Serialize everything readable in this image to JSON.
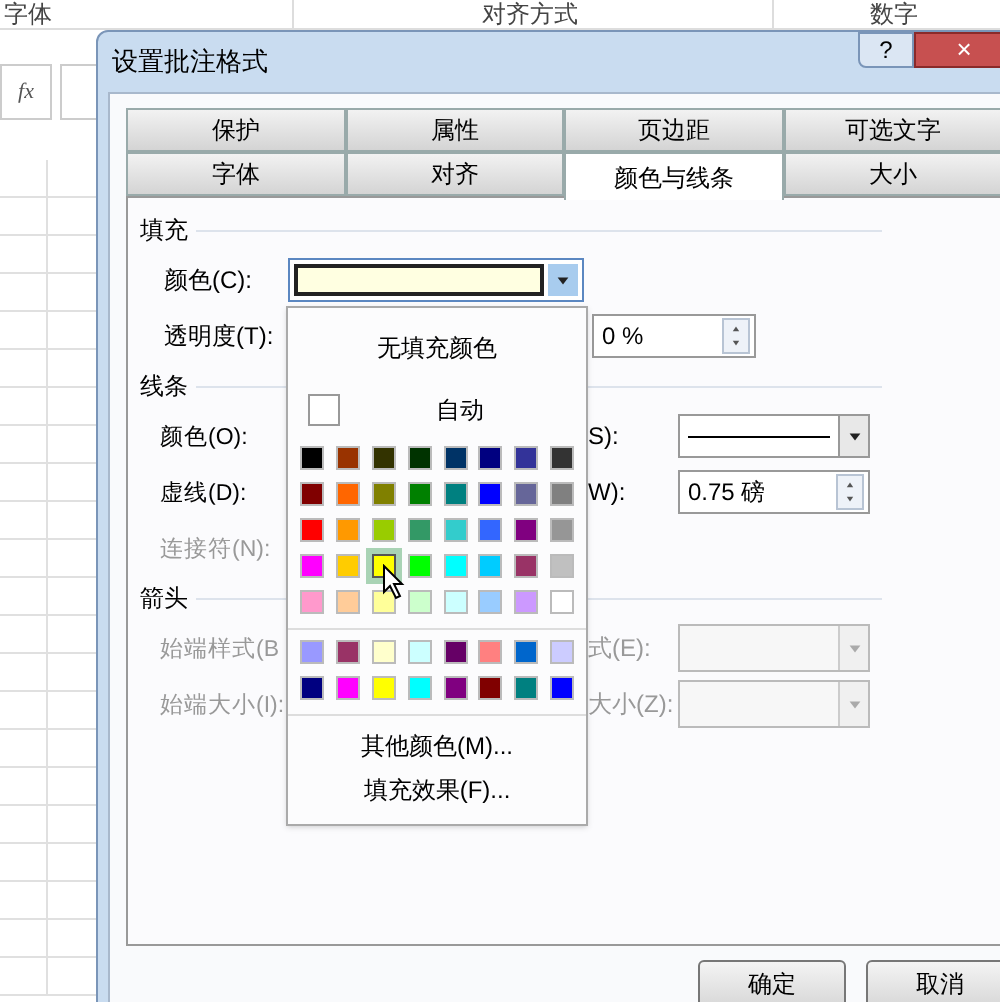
{
  "ribbon_groups": [
    "字体",
    "对齐方式",
    "数字"
  ],
  "formula_bar": {
    "fx": "fx"
  },
  "window": {
    "title": "设置批注格式",
    "help": "?",
    "close": "×"
  },
  "tab_rows": [
    [
      {
        "label": "保护",
        "selected": false
      },
      {
        "label": "属性",
        "selected": false
      },
      {
        "label": "页边距",
        "selected": false
      },
      {
        "label": "可选文字",
        "selected": false
      }
    ],
    [
      {
        "label": "字体",
        "selected": false
      },
      {
        "label": "对齐",
        "selected": false
      },
      {
        "label": "颜色与线条",
        "selected": true
      },
      {
        "label": "大小",
        "selected": false
      }
    ]
  ],
  "fill": {
    "title": "填充",
    "color_label": "颜色(C):",
    "transparency_label": "透明度(T):",
    "transparency_value": "0 %"
  },
  "line": {
    "title": "线条",
    "rows": [
      {
        "label": "颜色(O):",
        "disabled": false,
        "right_label": "S):",
        "kind": "line"
      },
      {
        "label": "虚线(D):",
        "disabled": false,
        "right_label": "W):",
        "kind": "spin",
        "right_value": "0.75 磅"
      },
      {
        "label": "连接符(N):",
        "disabled": true
      }
    ]
  },
  "arrows": {
    "title": "箭头",
    "rows": [
      {
        "label": "始端样式(B",
        "disabled": true,
        "right_label": "式(E):",
        "kind": "combo"
      },
      {
        "label": "始端大小(I):",
        "disabled": true,
        "right_label": "大小(Z):",
        "kind": "combo"
      }
    ]
  },
  "color_popup": {
    "no_fill": "无填充颜色",
    "auto": "自动",
    "more_colors": "其他颜色(M)...",
    "fill_effects": "填充效果(F)...",
    "swatch_groups": [
      {
        "swatches": [
          {
            "color": "#000000",
            "selected": false
          },
          {
            "color": "#993300",
            "selected": false
          },
          {
            "color": "#333300",
            "selected": false
          },
          {
            "color": "#003300",
            "selected": false
          },
          {
            "color": "#003366",
            "selected": false
          },
          {
            "color": "#000080",
            "selected": false
          },
          {
            "color": "#333399",
            "selected": false
          },
          {
            "color": "#333333",
            "selected": false
          },
          {
            "color": "#800000",
            "selected": false
          },
          {
            "color": "#ff6600",
            "selected": false
          },
          {
            "color": "#808000",
            "selected": false
          },
          {
            "color": "#008000",
            "selected": false
          },
          {
            "color": "#008080",
            "selected": false
          },
          {
            "color": "#0000ff",
            "selected": false
          },
          {
            "color": "#666699",
            "selected": false
          },
          {
            "color": "#808080",
            "selected": false
          },
          {
            "color": "#ff0000",
            "selected": false
          },
          {
            "color": "#ff9900",
            "selected": false
          },
          {
            "color": "#99cc00",
            "selected": false
          },
          {
            "color": "#339966",
            "selected": false
          },
          {
            "color": "#33cccc",
            "selected": false
          },
          {
            "color": "#3366ff",
            "selected": false
          },
          {
            "color": "#800080",
            "selected": false
          },
          {
            "color": "#969696",
            "selected": false
          },
          {
            "color": "#ff00ff",
            "selected": false
          },
          {
            "color": "#ffcc00",
            "selected": false
          },
          {
            "color": "#ffff00",
            "selected": true
          },
          {
            "color": "#00ff00",
            "selected": false
          },
          {
            "color": "#00ffff",
            "selected": false
          },
          {
            "color": "#00ccff",
            "selected": false
          },
          {
            "color": "#993366",
            "selected": false
          },
          {
            "color": "#c0c0c0",
            "selected": false
          },
          {
            "color": "#ff99cc",
            "selected": false
          },
          {
            "color": "#ffcc99",
            "selected": false
          },
          {
            "color": "#ffff99",
            "selected": false
          },
          {
            "color": "#ccffcc",
            "selected": false
          },
          {
            "color": "#ccffff",
            "selected": false
          },
          {
            "color": "#99ccff",
            "selected": false
          },
          {
            "color": "#cc99ff",
            "selected": false
          },
          {
            "color": "#ffffff",
            "selected": false
          }
        ]
      },
      {
        "swatches": [
          {
            "color": "#9999ff",
            "selected": false
          },
          {
            "color": "#993366",
            "selected": false
          },
          {
            "color": "#ffffcc",
            "selected": false
          },
          {
            "color": "#ccffff",
            "selected": false
          },
          {
            "color": "#660066",
            "selected": false
          },
          {
            "color": "#ff8080",
            "selected": false
          },
          {
            "color": "#0066cc",
            "selected": false
          },
          {
            "color": "#ccccff",
            "selected": false
          },
          {
            "color": "#000080",
            "selected": false
          },
          {
            "color": "#ff00ff",
            "selected": false
          },
          {
            "color": "#ffff00",
            "selected": false
          },
          {
            "color": "#00ffff",
            "selected": false
          },
          {
            "color": "#800080",
            "selected": false
          },
          {
            "color": "#800000",
            "selected": false
          },
          {
            "color": "#008080",
            "selected": false
          },
          {
            "color": "#0000ff",
            "selected": false
          }
        ]
      }
    ]
  },
  "buttons": [
    "确定",
    "取消"
  ]
}
